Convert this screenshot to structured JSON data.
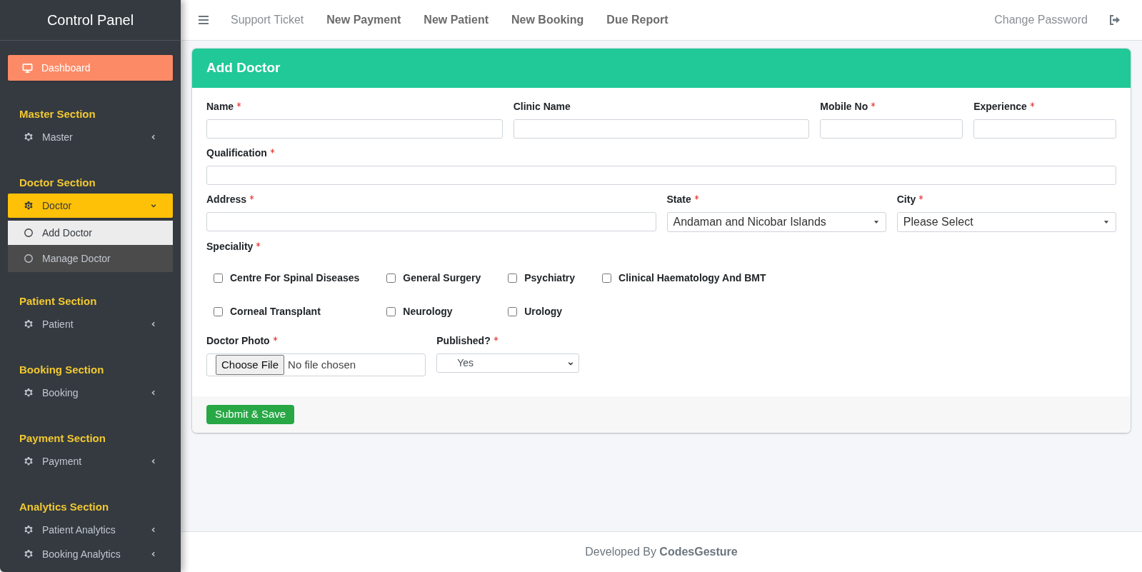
{
  "sidebar": {
    "title": "Control Panel",
    "items": [
      {
        "kind": "link",
        "label": "Dashboard"
      },
      {
        "kind": "heading",
        "label": "Master Section"
      },
      {
        "kind": "menu",
        "label": "Master",
        "expanded": false
      },
      {
        "kind": "heading",
        "label": "Doctor Section"
      },
      {
        "kind": "menu",
        "label": "Doctor",
        "expanded": true,
        "children": [
          {
            "label": "Add Doctor",
            "selected": true
          },
          {
            "label": "Manage Doctor",
            "selected": false
          }
        ]
      },
      {
        "kind": "heading",
        "label": "Patient Section"
      },
      {
        "kind": "menu",
        "label": "Patient",
        "expanded": false
      },
      {
        "kind": "heading",
        "label": "Booking Section"
      },
      {
        "kind": "menu",
        "label": "Booking",
        "expanded": false
      },
      {
        "kind": "heading",
        "label": "Payment Section"
      },
      {
        "kind": "menu",
        "label": "Payment",
        "expanded": false
      },
      {
        "kind": "heading",
        "label": "Analytics Section"
      },
      {
        "kind": "menu",
        "label": "Patient Analytics",
        "expanded": false
      },
      {
        "kind": "menu",
        "label": "Booking Analytics",
        "expanded": false
      }
    ]
  },
  "topbar": {
    "links": [
      {
        "label": "Support Ticket",
        "kind": "plain"
      },
      {
        "label": "New Payment",
        "kind": "strong"
      },
      {
        "label": "New Patient",
        "kind": "strong"
      },
      {
        "label": "New Booking",
        "kind": "strong"
      },
      {
        "label": "Due Report",
        "kind": "strong"
      }
    ],
    "right_link": "Change Password"
  },
  "card": {
    "title": "Add Doctor",
    "rows": [
      [
        {
          "label": "Name",
          "required": true,
          "kind": "text"
        },
        {
          "label": "Clinic Name",
          "required": false,
          "kind": "text"
        },
        {
          "label": "Mobile No",
          "required": true,
          "kind": "text"
        },
        {
          "label": "Experience",
          "required": true,
          "kind": "text"
        }
      ],
      [
        {
          "label": "Qualification",
          "required": true,
          "kind": "text"
        }
      ],
      [
        {
          "label": "Address",
          "required": true,
          "kind": "text"
        },
        {
          "label": "State",
          "required": true,
          "kind": "combo",
          "value": "Andaman and Nicobar Islands"
        },
        {
          "label": "City",
          "required": true,
          "kind": "combo",
          "value": "Please Select"
        }
      ]
    ],
    "speciality": {
      "label": "Speciality",
      "required": true,
      "options": [
        {
          "label": "Centre For Spinal Diseases",
          "checked": false
        },
        {
          "label": "General Surgery",
          "checked": false
        },
        {
          "label": "Psychiatry",
          "checked": false
        },
        {
          "label": "Clinical Haematology And BMT",
          "checked": false
        },
        {
          "label": "Corneal Transplant",
          "checked": false
        },
        {
          "label": "Neurology",
          "checked": false
        },
        {
          "label": "Urology",
          "checked": false
        }
      ]
    },
    "last_row": [
      {
        "label": "Doctor Photo",
        "required": true,
        "kind": "file",
        "button": "Choose File",
        "value": "No file chosen"
      },
      {
        "label": "Published?",
        "required": true,
        "kind": "select",
        "value": "Yes"
      }
    ],
    "submit": "Submit & Save"
  },
  "footer": "Developed By **CodesGesture**"
}
